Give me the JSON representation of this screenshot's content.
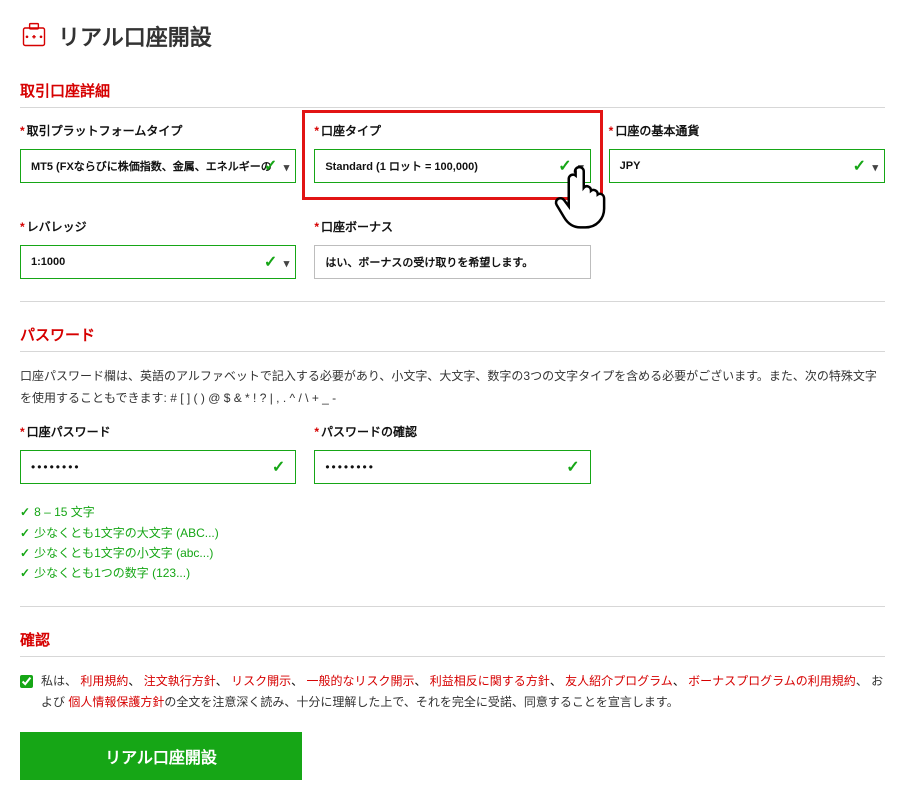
{
  "page": {
    "title": "リアル口座開設"
  },
  "section1": {
    "heading": "取引口座詳細",
    "platform": {
      "label": "取引プラットフォームタイプ",
      "value": "MT5 (FXならびに株価指数、金属、エネルギーの"
    },
    "acct_type": {
      "label": "口座タイプ",
      "value": "Standard (1 ロット = 100,000)"
    },
    "currency": {
      "label": "口座の基本通貨",
      "value": "JPY"
    },
    "leverage": {
      "label": "レバレッジ",
      "value": "1:1000"
    },
    "bonus": {
      "label": "口座ボーナス",
      "value": "はい、ボーナスの受け取りを希望します。"
    }
  },
  "section2": {
    "heading": "パスワード",
    "hint": "口座パスワード欄は、英語のアルファベットで記入する必要があり、小文字、大文字、数字の3つの文字タイプを含める必要がございます。また、次の特殊文字を使用することもできます: # [ ] ( ) @ $ & * ! ? | , . ^ / \\ + _ -",
    "pw": {
      "label": "口座パスワード",
      "value": "••••••••"
    },
    "pw2": {
      "label": "パスワードの確認",
      "value": "••••••••"
    },
    "reqs": [
      "8 – 15 文字",
      "少なくとも1文字の大文字 (ABC...)",
      "少なくとも1文字の小文字 (abc...)",
      "少なくとも1つの数字 (123...)"
    ]
  },
  "section3": {
    "heading": "確認",
    "agree": {
      "before": "私は、",
      "links": [
        "利用規約",
        "注文執行方針",
        "リスク開示",
        "一般的なリスク開示",
        "利益相反に関する方針",
        "友人紹介プログラム",
        "ボーナスプログラムの利用規約"
      ],
      "mid": "、 および",
      "link_after": "個人情報保護方針",
      "tail": "の全文を注意深く読み、十分に理解した上で、それを完全に受諾、同意することを宣言します。",
      "checked": true
    },
    "submit": "リアル口座開設"
  }
}
